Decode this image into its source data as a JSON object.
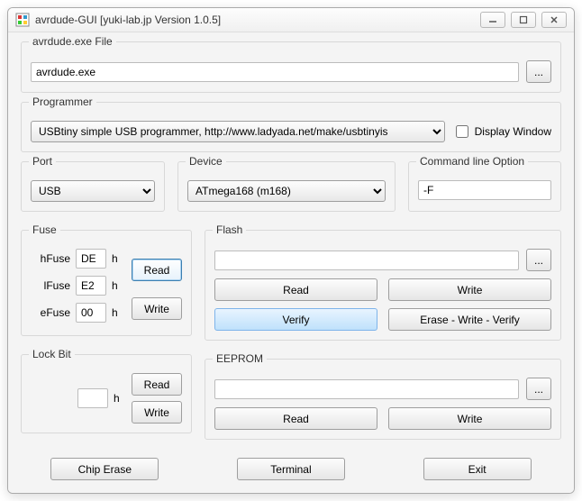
{
  "window": {
    "title": "avrdude-GUI [yuki-lab.jp Version 1.0.5]"
  },
  "avrdude_file": {
    "label": "avrdude.exe File",
    "value": "avrdude.exe",
    "browse": "..."
  },
  "programmer": {
    "label": "Programmer",
    "value": "USBtiny simple USB programmer, http://www.ladyada.net/make/usbtinyis",
    "display_window_label": "Display Window"
  },
  "port": {
    "label": "Port",
    "value": "USB"
  },
  "device": {
    "label": "Device",
    "value": "ATmega168 (m168)"
  },
  "cmdline": {
    "label": "Command line Option",
    "value": "-F"
  },
  "fuse": {
    "label": "Fuse",
    "h_label": "hFuse",
    "h_val": "DE",
    "l_label": "lFuse",
    "l_val": "E2",
    "e_label": "eFuse",
    "e_val": "00",
    "hex_suffix": "h",
    "read_btn": "Read",
    "write_btn": "Write"
  },
  "flash": {
    "label": "Flash",
    "value": "",
    "browse": "...",
    "read_btn": "Read",
    "write_btn": "Write",
    "verify_btn": "Verify",
    "ewv_btn": "Erase - Write - Verify"
  },
  "lockbit": {
    "label": "Lock Bit",
    "value": "",
    "hex_suffix": "h",
    "read_btn": "Read",
    "write_btn": "Write"
  },
  "eeprom": {
    "label": "EEPROM",
    "value": "",
    "browse": "...",
    "read_btn": "Read",
    "write_btn": "Write"
  },
  "bottom": {
    "chip_erase": "Chip Erase",
    "terminal": "Terminal",
    "exit": "Exit"
  }
}
